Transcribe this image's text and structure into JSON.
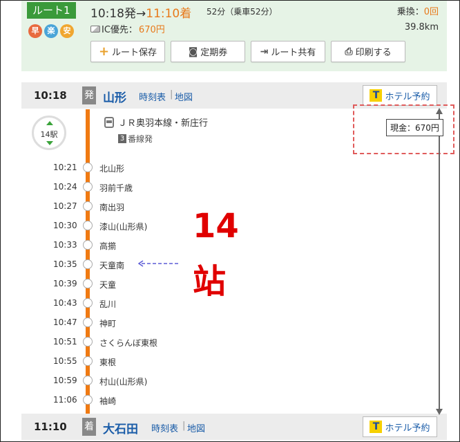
{
  "route": {
    "label": "ルート1",
    "depart_time": "10:18発→",
    "arrive_time": "11:10着",
    "duration": "52分（乗車52分）",
    "transfer_label": "乗換：",
    "transfer_count": "0回",
    "badges": [
      {
        "text": "早",
        "name": "fast"
      },
      {
        "text": "楽",
        "name": "easy"
      },
      {
        "text": "安",
        "name": "cheap"
      }
    ],
    "ic_label": "IC優先：",
    "ic_price": "670円",
    "distance": "39.8km",
    "accent_color": "#e8791a",
    "header_bg": "#e6f3e6"
  },
  "actions": {
    "save": "ルート保存",
    "commuter": "定期券",
    "share": "ルート共有",
    "print": "印刷する"
  },
  "departure": {
    "time": "10:18",
    "mark": "発",
    "station": "山形",
    "timetable": "時刻表",
    "map": "地図",
    "hotel": "ホテル予約"
  },
  "arrival": {
    "time": "11:10",
    "mark": "着",
    "station": "大石田",
    "timetable": "時刻表",
    "map": "地図",
    "hotel": "ホテル予約"
  },
  "separator": "|",
  "hotel_icon": "T",
  "segment": {
    "stop_count": "14駅",
    "train": "ＪＲ奥羽本線・新庄行",
    "platform_number": "3",
    "platform_suffix": "番線発",
    "line_color": "#f07a12"
  },
  "stops": [
    {
      "time": "10:21",
      "name": "北山形"
    },
    {
      "time": "10:24",
      "name": "羽前千歳"
    },
    {
      "time": "10:27",
      "name": "南出羽"
    },
    {
      "time": "10:30",
      "name": "漆山(山形県)"
    },
    {
      "time": "10:33",
      "name": "高擶"
    },
    {
      "time": "10:35",
      "name": "天童南"
    },
    {
      "time": "10:39",
      "name": "天童"
    },
    {
      "time": "10:43",
      "name": "乱川"
    },
    {
      "time": "10:47",
      "name": "神町"
    },
    {
      "time": "10:51",
      "name": "さくらんぼ東根"
    },
    {
      "time": "10:55",
      "name": "東根"
    },
    {
      "time": "10:59",
      "name": "村山(山形県)"
    },
    {
      "time": "11:06",
      "name": "袖崎"
    }
  ],
  "annotations": {
    "cash": "現金：670円",
    "big_number": "14",
    "big_char": "站",
    "highlight_color": "#e00000"
  }
}
